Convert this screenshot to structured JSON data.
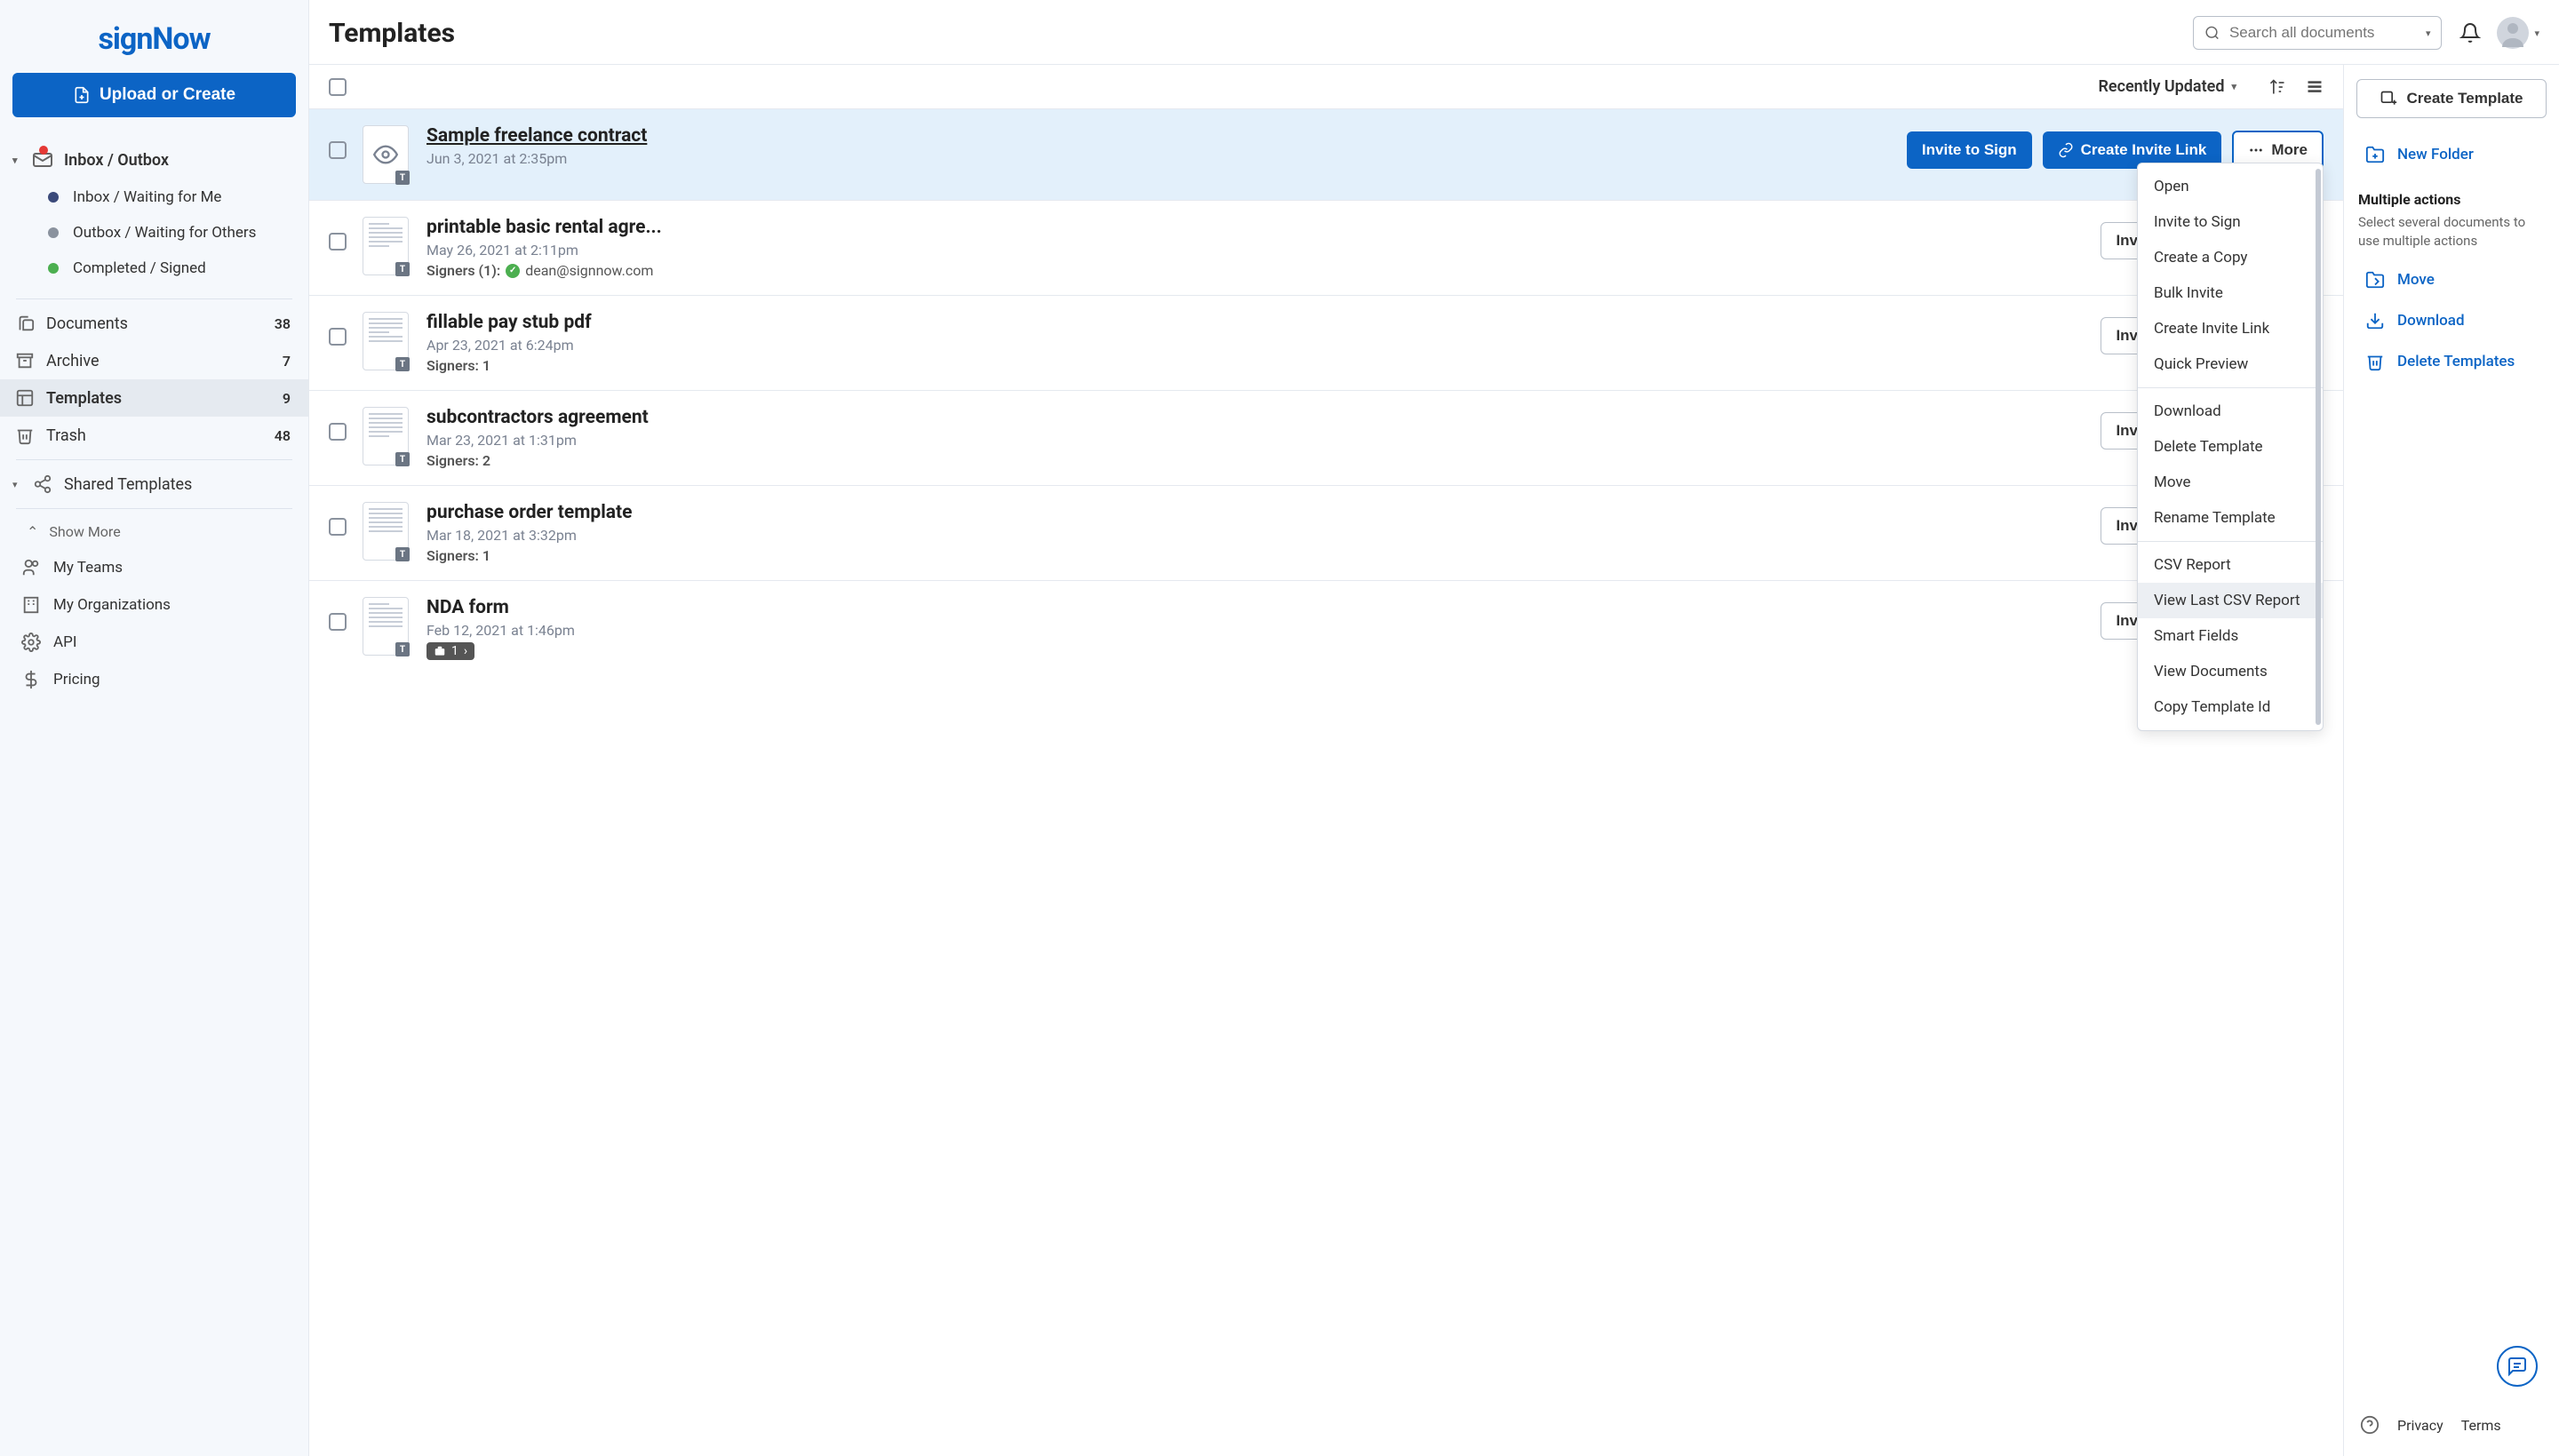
{
  "brand": "signNow",
  "upload_button": "Upload or Create",
  "sidebar": {
    "inbox_outbox": "Inbox / Outbox",
    "sub": [
      {
        "label": "Inbox / Waiting for Me",
        "color": "#3b4a7a"
      },
      {
        "label": "Outbox / Waiting for Others",
        "color": "#8a929e"
      },
      {
        "label": "Completed / Signed",
        "color": "#4caf50"
      }
    ],
    "items": [
      {
        "label": "Documents",
        "count": "38"
      },
      {
        "label": "Archive",
        "count": "7"
      },
      {
        "label": "Templates",
        "count": "9"
      },
      {
        "label": "Trash",
        "count": "48"
      }
    ],
    "shared_templates": "Shared Templates",
    "show_more": "Show More",
    "bottom": [
      {
        "label": "My Teams"
      },
      {
        "label": "My Organizations"
      },
      {
        "label": "API"
      },
      {
        "label": "Pricing"
      }
    ]
  },
  "header": {
    "title": "Templates",
    "search_placeholder": "Search all documents"
  },
  "list": {
    "sort_label": "Recently Updated",
    "invite_label": "Invite to Sign",
    "create_link_label": "Create Invite Link",
    "create_link_short": "Crea",
    "more_label": "More",
    "rows": [
      {
        "title": "Sample freelance contract",
        "date": "Jun 3, 2021 at 2:35pm",
        "signers": "",
        "email": ""
      },
      {
        "title": "printable basic rental agre...",
        "date": "May 26, 2021 at 2:11pm",
        "signers": "Signers (1):",
        "email": "dean@signnow.com"
      },
      {
        "title": "fillable pay stub pdf",
        "date": "Apr 23, 2021 at 6:24pm",
        "signers": "Signers: 1",
        "email": ""
      },
      {
        "title": "subcontractors agreement",
        "date": "Mar 23, 2021 at 1:31pm",
        "signers": "Signers: 2",
        "email": ""
      },
      {
        "title": "purchase order template",
        "date": "Mar 18, 2021 at 3:32pm",
        "signers": "Signers: 1",
        "email": ""
      },
      {
        "title": "NDA form",
        "date": "Feb 12, 2021 at 1:46pm",
        "signers": "",
        "email": "",
        "briefcase": "1"
      }
    ]
  },
  "dropdown": {
    "items_a": [
      "Open",
      "Invite to Sign",
      "Create a Copy",
      "Bulk Invite",
      "Create Invite Link",
      "Quick Preview"
    ],
    "items_b": [
      "Download",
      "Delete Template",
      "Move",
      "Rename Template"
    ],
    "items_c": [
      "CSV Report",
      "View Last CSV Report",
      "Smart Fields",
      "View Documents",
      "Copy Template Id"
    ],
    "highlighted": "View Last CSV Report"
  },
  "right_panel": {
    "create_template": "Create Template",
    "new_folder": "New Folder",
    "multi_title": "Multiple actions",
    "multi_desc": "Select several documents to use multiple actions",
    "actions": [
      "Move",
      "Download",
      "Delete Templates"
    ],
    "privacy": "Privacy",
    "terms": "Terms"
  }
}
